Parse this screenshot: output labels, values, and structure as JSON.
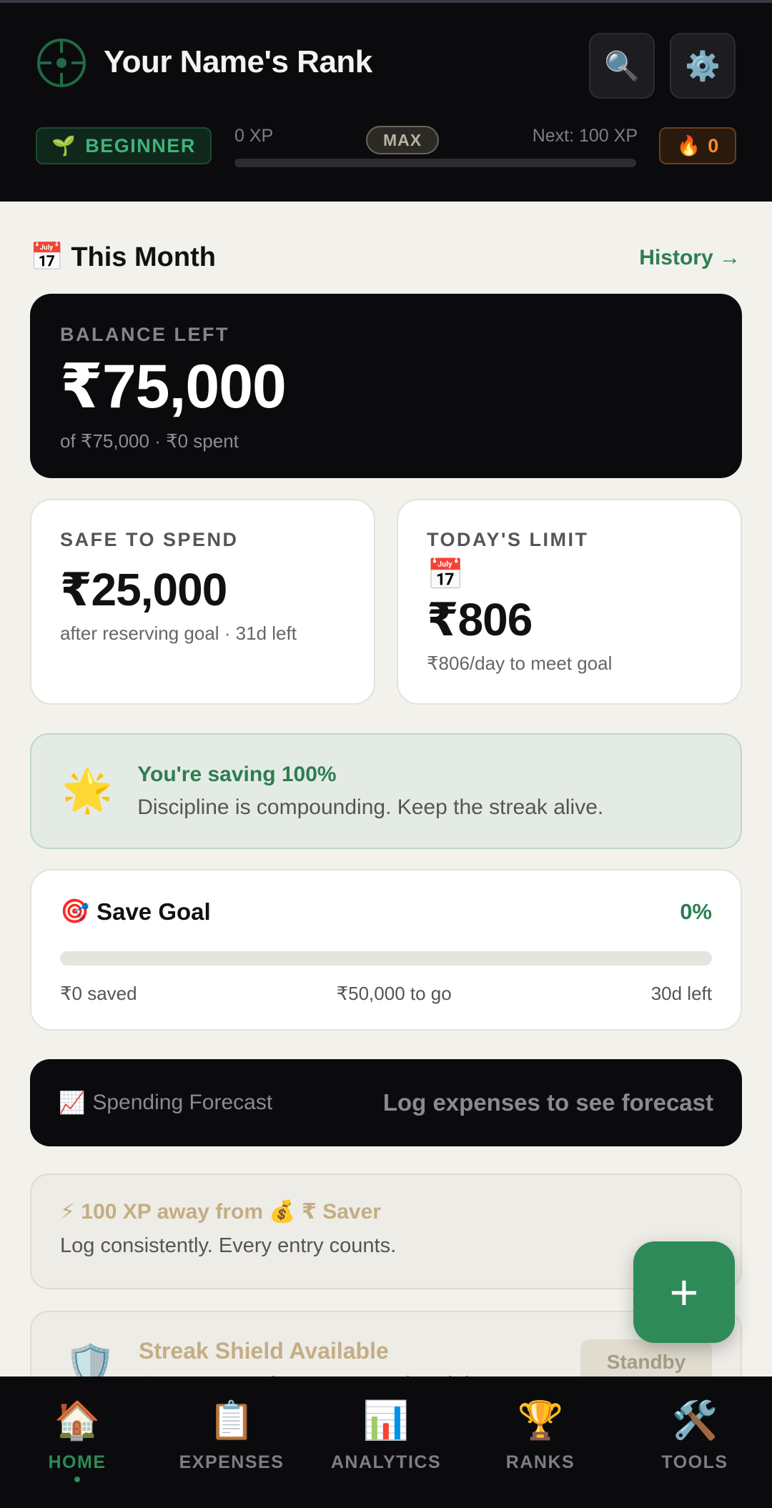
{
  "header": {
    "title": "Your Name's Rank",
    "rank_label": "BEGINNER",
    "rank_emoji": "🌱",
    "xp_current": "0 XP",
    "xp_max_label": "MAX",
    "xp_next": "Next: 100 XP",
    "xp_progress": 0,
    "streak_emoji": "🔥",
    "streak_count": "0",
    "search_icon": "🔍",
    "settings_icon": "⚙️"
  },
  "month": {
    "emoji": "📅",
    "title": "This Month",
    "history_link": "History →"
  },
  "balance": {
    "label": "BALANCE LEFT",
    "amount": "₹75,000",
    "sub": "of ₹75,000 · ₹0 spent"
  },
  "safe_to_spend": {
    "label": "SAFE TO SPEND",
    "amount": "₹25,000",
    "sub": "after reserving goal · 31d left"
  },
  "today_limit": {
    "label": "TODAY'S LIMIT",
    "emoji": "📅",
    "amount": "₹806",
    "sub": "₹806/day to meet goal"
  },
  "saving": {
    "emoji": "🌟",
    "title": "You're saving 100%",
    "sub": "Discipline is compounding. Keep the streak alive."
  },
  "goal": {
    "emoji": "🎯",
    "title": "Save Goal",
    "percent": "0%",
    "progress": 0,
    "saved": "₹0 saved",
    "to_go": "₹50,000 to go",
    "days_left": "30d left"
  },
  "forecast": {
    "emoji": "📈",
    "label": "Spending Forecast",
    "value": "Log expenses to see forecast"
  },
  "xp_away": {
    "title": "⚡ 100 XP away from 💰 ₹ Saver",
    "sub": "Log consistently. Every entry counts."
  },
  "shield": {
    "emoji": "🛡️",
    "title": "Streak Shield Available",
    "sub": "Once per month. Protects a missed day.",
    "button": "Standby"
  },
  "fab": {
    "label": "+"
  },
  "nav": [
    {
      "label": "HOME",
      "icon": "🏠",
      "active": true
    },
    {
      "label": "EXPENSES",
      "icon": "📋",
      "active": false
    },
    {
      "label": "ANALYTICS",
      "icon": "📊",
      "active": false
    },
    {
      "label": "RANKS",
      "icon": "🏆",
      "active": false
    },
    {
      "label": "TOOLS",
      "icon": "🛠️",
      "active": false
    }
  ],
  "colors": {
    "accent": "#2e8b57",
    "dark": "#0b0b0e",
    "background": "#f2f1ec"
  }
}
